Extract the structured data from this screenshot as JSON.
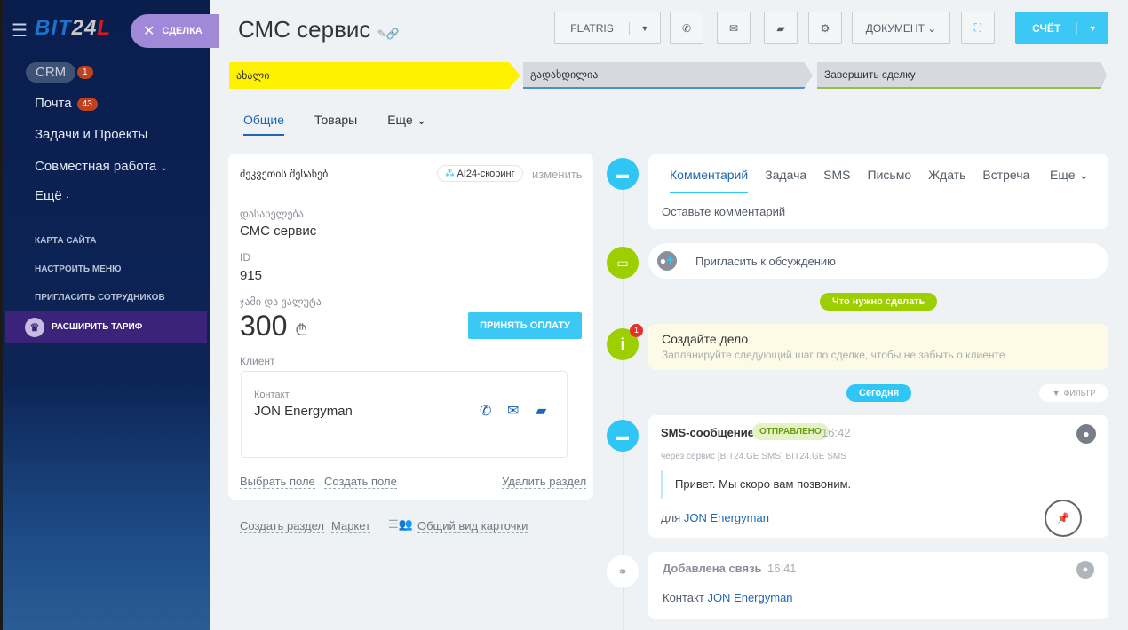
{
  "sidebar": {
    "logo": {
      "a": "BIT",
      "b": "24",
      "c": "L"
    },
    "deal_tab": "СДЕЛКА",
    "items": [
      {
        "label": "CRM",
        "badge": "1"
      },
      {
        "label": "Почта",
        "badge": "43"
      },
      {
        "label": "Задачи и Проекты"
      },
      {
        "label": "Совместная работа"
      },
      {
        "label": "Ещё"
      }
    ],
    "links": [
      "КАРТА САЙТА",
      "НАСТРОИТЬ МЕНЮ",
      "ПРИГЛАСИТЬ СОТРУДНИКОВ"
    ],
    "upgrade": "РАСШИРИТЬ ТАРИФ"
  },
  "header": {
    "title": "СМС сервис",
    "flatris": "FLATRIS",
    "document": "ДОКУМЕНТ",
    "invoice": "СЧЁТ"
  },
  "stages": [
    "ახალი",
    "გადახდილია",
    "Завершить сделку"
  ],
  "tabs": [
    "Общие",
    "Товары",
    "Еще"
  ],
  "card": {
    "section_title": "შეკვეთის შესახებ",
    "scoring": "AI24-скоринг",
    "edit": "изменить",
    "name_label": "დასახელება",
    "name": "СМС сервис",
    "id_label": "ID",
    "id": "915",
    "amount_label": "ჯამი და ვალუტა",
    "amount": "300",
    "currency": "₾",
    "pay": "ПРИНЯТЬ ОПЛАТУ",
    "client_label": "Клиент",
    "contact_label": "Контакт",
    "contact": "JON Energyman",
    "select_field": "Выбрать поле",
    "create_field": "Создать поле",
    "delete_section": "Удалить раздел"
  },
  "bottom_links": [
    "Создать раздел",
    "Маркет",
    "Общий вид карточки"
  ],
  "timeline": {
    "tabs": [
      "Комментарий",
      "Задача",
      "SMS",
      "Письмо",
      "Ждать",
      "Встреча",
      "Еще"
    ],
    "comment_placeholder": "Оставьте комментарий",
    "invite": "Пригласить к обсуждению",
    "todo_pill": "Что нужно сделать",
    "task_badge": "1",
    "task_title": "Создайте дело",
    "task_text": "Запланируйте следующий шаг по сделке, чтобы не забыть о клиенте",
    "today": "Сегодня",
    "filter": "ФИЛЬТР",
    "sms": {
      "title": "SMS-сообщение",
      "status": "ОТПРАВЛЕНО",
      "time": "16:42",
      "via": "через сервис [BIT24.GE SMS] BIT24.GE SMS",
      "text": "Привет. Мы скоро вам позвоним.",
      "for": "для",
      "to": "JON Energyman"
    },
    "link": {
      "title": "Добавлена связь",
      "time": "16:41",
      "label": "Контакт",
      "contact": "JON Energyman"
    }
  }
}
